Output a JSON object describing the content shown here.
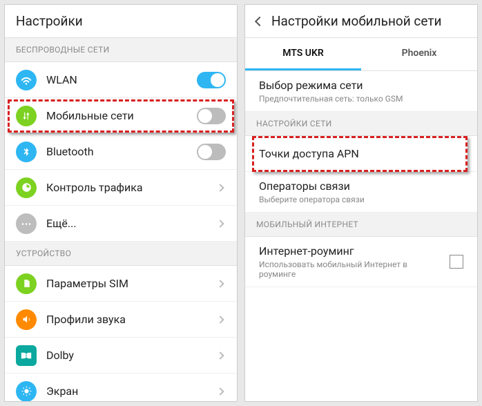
{
  "left": {
    "title": "Настройки",
    "section_wireless": "БЕСПРОВОДНЫЕ СЕТИ",
    "wlan": "WLAN",
    "mobile": "Мобильные сети",
    "bluetooth": "Bluetooth",
    "traffic": "Контроль трафика",
    "more": "Ещё...",
    "section_device": "УСТРОЙСТВО",
    "sim": "Параметры SIM",
    "sound": "Профили звука",
    "dolby": "Dolby",
    "screen": "Экран"
  },
  "right": {
    "title": "Настройки мобильной сети",
    "tab1": "MTS UKR",
    "tab2": "Phoenix",
    "mode_title": "Выбор режима сети",
    "mode_sub": "Предпочтительная сеть: только GSM",
    "section_net": "НАСТРОЙКИ СЕТИ",
    "apn": "Точки доступа APN",
    "operators_title": "Операторы связи",
    "operators_sub": "Выберите оператора связи",
    "section_internet": "МОБИЛЬНЫЙ ИНТЕРНЕТ",
    "roaming_title": "Интернет-роуминг",
    "roaming_sub": "Использовать мобильный Интернет в роуминге"
  }
}
